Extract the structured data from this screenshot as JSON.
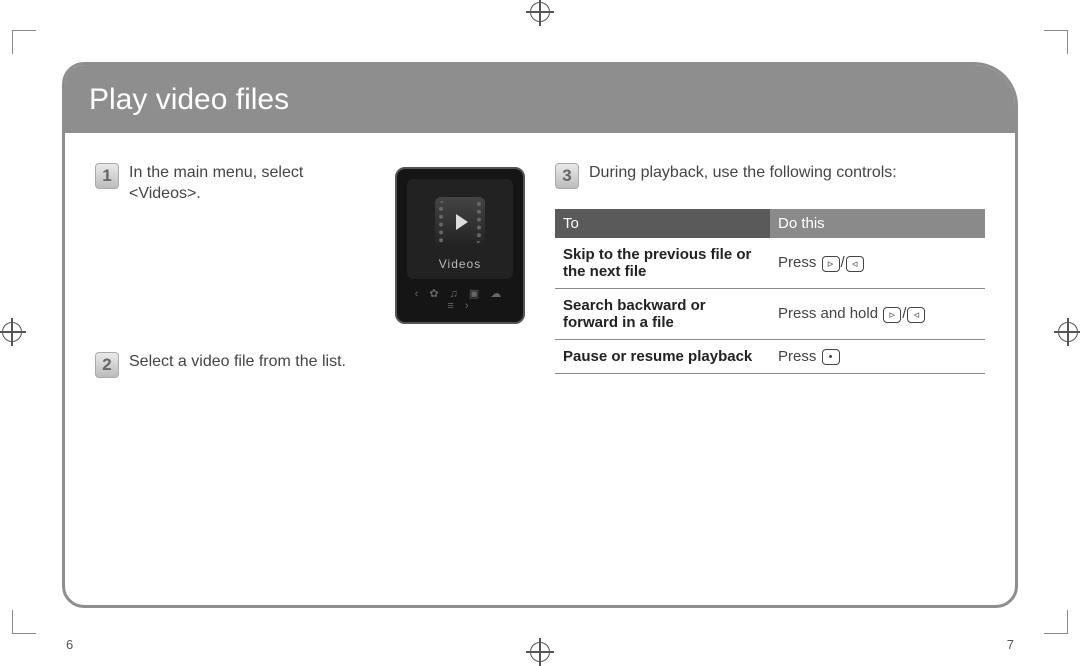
{
  "header": {
    "title": "Play video files"
  },
  "page_numbers": {
    "left": "6",
    "right": "7"
  },
  "left_col": {
    "step1": {
      "num": "1",
      "text": "In the main menu, select <Videos>."
    },
    "device": {
      "label": "Videos",
      "nav": "‹ ✿ ♫ ▣ ☁ ≡ ›"
    },
    "step2": {
      "num": "2",
      "text": "Select a video file from the list."
    }
  },
  "right_col": {
    "step3": {
      "num": "3",
      "text": "During playback, use the following controls:"
    },
    "table": {
      "head": {
        "c1": "To",
        "c2": "Do this"
      },
      "rows": [
        {
          "k": "Skip to the previous file or the next file",
          "v_prefix": "Press ",
          "btns": [
            "▹",
            "◃"
          ],
          "sep": "/"
        },
        {
          "k": "Search backward or forward in a file",
          "v_prefix": "Press and hold ",
          "btns": [
            "▹",
            "◃"
          ],
          "sep": "/"
        },
        {
          "k": "Pause or resume playback",
          "v_prefix": "Press ",
          "btns": [
            "•"
          ],
          "sep": ""
        }
      ]
    }
  }
}
